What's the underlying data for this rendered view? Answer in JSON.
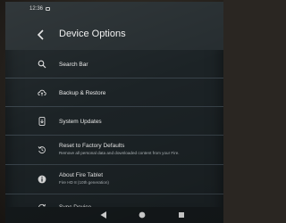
{
  "status_bar": {
    "time": "12:36"
  },
  "header": {
    "title": "Device Options"
  },
  "rows": [
    {
      "label": "Search Bar",
      "icon": "search-icon"
    },
    {
      "label": "Backup & Restore",
      "icon": "cloud-sync-icon"
    },
    {
      "label": "System Updates",
      "icon": "system-update-icon"
    },
    {
      "label": "Reset to Factory Defaults",
      "subtitle": "Remove all personal data and downloaded content from your Fire.",
      "icon": "reset-icon"
    },
    {
      "label": "About Fire Tablet",
      "subtitle": "Fire HD 8 (10th generation)",
      "icon": "info-icon"
    },
    {
      "label": "Sync Device",
      "icon": "sync-icon"
    }
  ],
  "nav_bar": {
    "buttons": [
      "back-icon",
      "home-icon",
      "recents-icon"
    ]
  }
}
